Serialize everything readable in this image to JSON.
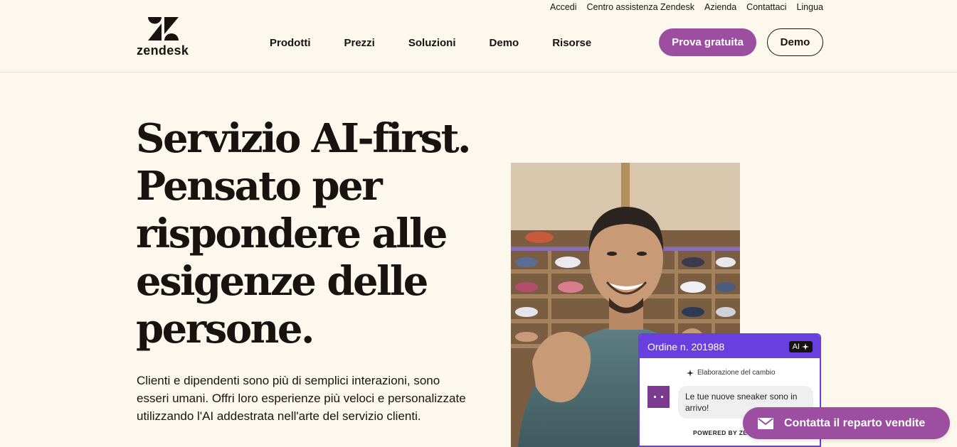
{
  "brand": {
    "name": "zendesk",
    "icon": "zendesk-logo",
    "color": "#17140f"
  },
  "utility_nav": [
    "Accedi",
    "Centro assistenza Zendesk",
    "Azienda",
    "Contattaci",
    "Lingua"
  ],
  "main_nav": [
    "Prodotti",
    "Prezzi",
    "Soluzioni",
    "Demo",
    "Risorse"
  ],
  "header_buttons": {
    "trial": "Prova gratuita",
    "demo": "Demo"
  },
  "hero": {
    "title": "Servizio AI-first. Pensato per rispondere alle esigenze delle persone.",
    "text": "Clienti e dipendenti sono più di semplici interazioni, sono esseri umani. Offri loro esperienze più veloci e personalizzate utilizzando l'AI addestrata nell'arte del servizio clienti."
  },
  "chat_widget": {
    "title": "Ordine n. 201988",
    "badge": "AI",
    "processing": "Elaborazione del cambio",
    "message": "Le tue nuove sneaker sono in arrivo!",
    "powered_by": "POWERED BY ZENDESK"
  },
  "sales_cta": {
    "label": "Contatta il reparto vendite",
    "icon": "mail-icon"
  },
  "colors": {
    "background": "#fdf8ed",
    "accent": "#9c4fa0",
    "chat_accent": "#6a3fe0",
    "text": "#17140f"
  }
}
